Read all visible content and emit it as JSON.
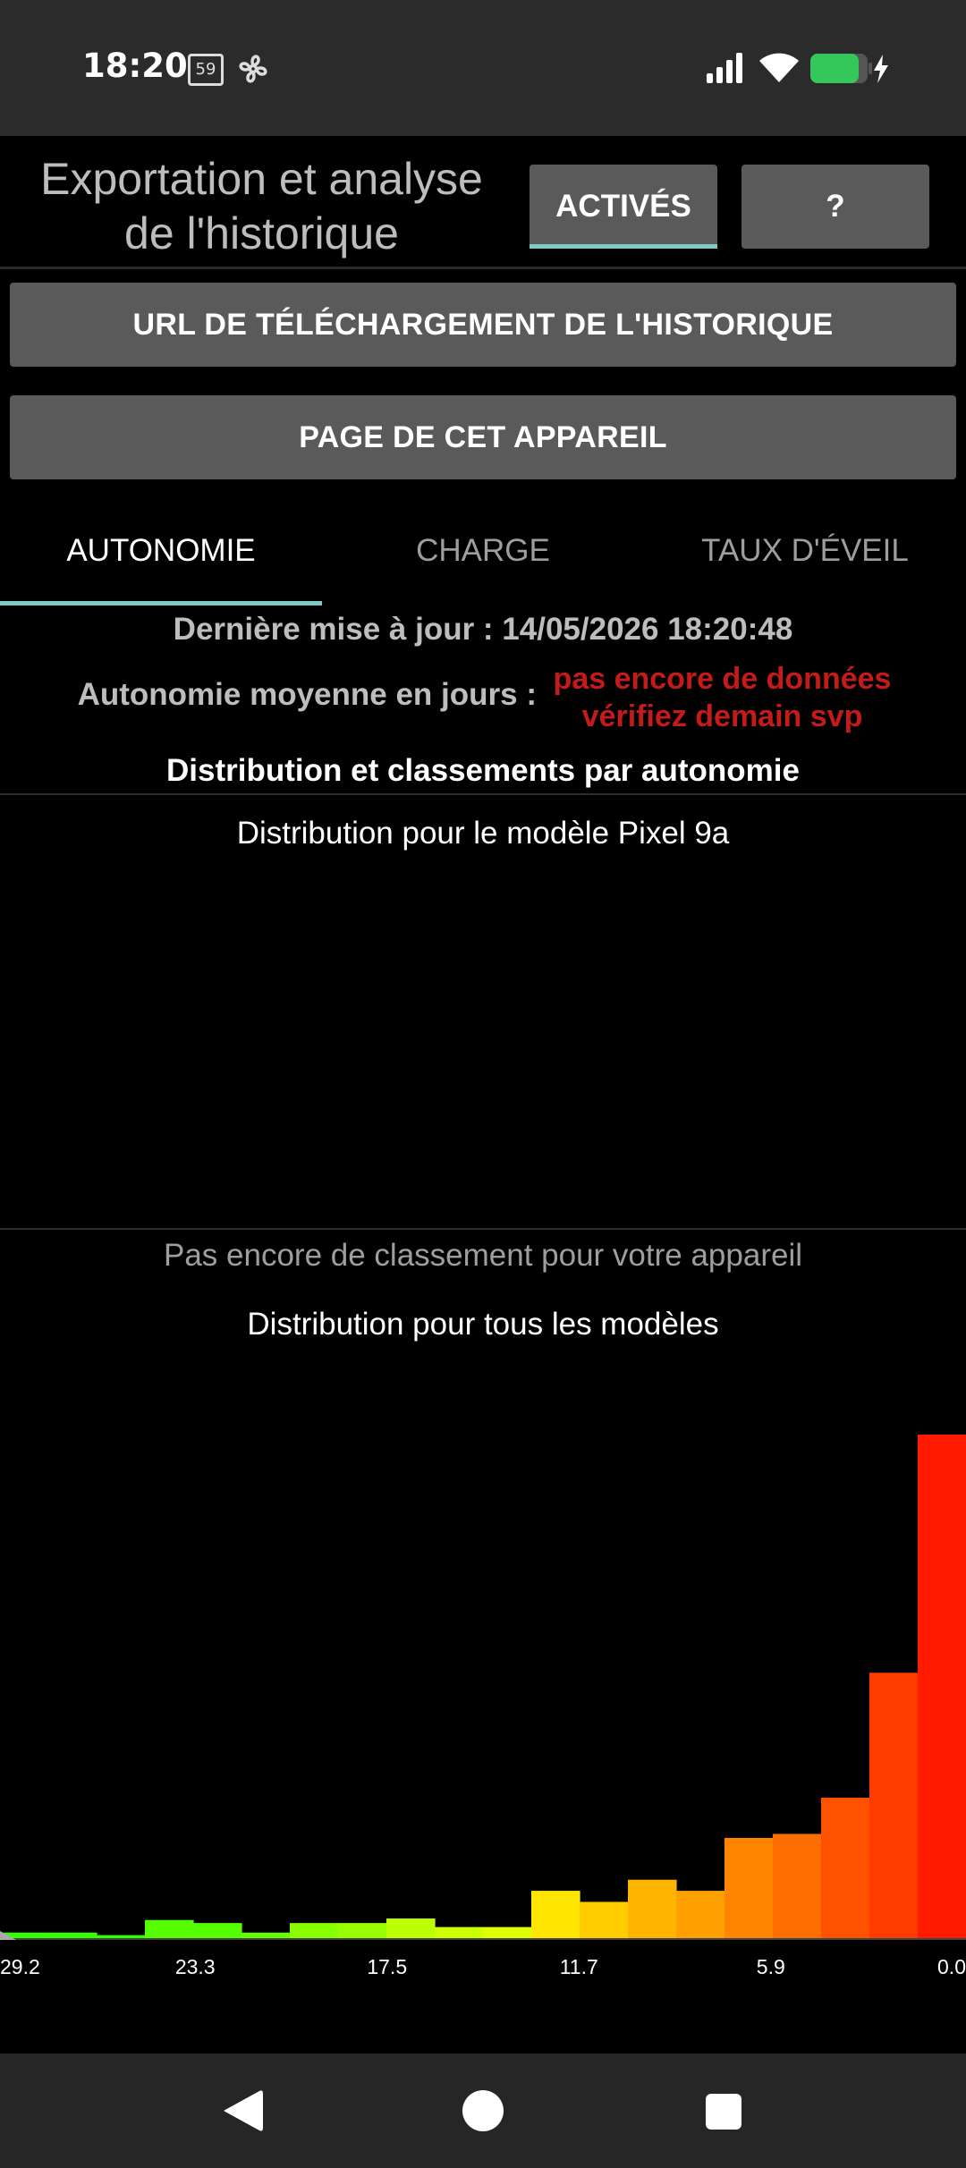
{
  "status_bar": {
    "time": "18:20",
    "calendar_badge": "59",
    "icons": [
      "calendar-icon",
      "fan-icon",
      "signal-icon",
      "wifi-icon",
      "battery-charging-icon"
    ],
    "battery_color": "#34c759"
  },
  "header": {
    "title": "Exportation et analyse de l'historique",
    "activated_label": "ACTIVÉS",
    "help_label": "?"
  },
  "buttons": {
    "history_url": "URL DE TÉLÉCHARGEMENT DE L'HISTORIQUE",
    "device_page": "PAGE DE CET APPAREIL"
  },
  "tabs": [
    {
      "label": "AUTONOMIE",
      "active": true
    },
    {
      "label": "CHARGE",
      "active": false
    },
    {
      "label": "TAUX D'ÉVEIL",
      "active": false
    }
  ],
  "info": {
    "last_update": "Dernière mise à jour : 14/05/2026 18:20:48",
    "avg_label": "Autonomie moyenne en jours  :",
    "avg_nodata_line1": "pas encore de données",
    "avg_nodata_line2": "vérifiez demain svp"
  },
  "section_title": "Distribution et classements par autonomie",
  "model_distribution": {
    "title": "Distribution pour le modèle Pixel 9a"
  },
  "no_rank_text": "Pas encore de classement pour votre appareil",
  "all_models_distribution": {
    "title": "Distribution pour tous les modèles"
  },
  "chart_data": {
    "type": "bar",
    "title": "Distribution pour tous les modèles",
    "xlabel": "",
    "ylabel": "",
    "x_ticks": [
      "29.2",
      "23.3",
      "17.5",
      "11.7",
      "5.9",
      "0.0"
    ],
    "x_range": [
      29.2,
      0.0
    ],
    "bin_count": 20,
    "values": [
      0.011,
      0.011,
      0.006,
      0.036,
      0.03,
      0.011,
      0.03,
      0.03,
      0.039,
      0.022,
      0.022,
      0.094,
      0.072,
      0.116,
      0.094,
      0.199,
      0.207,
      0.279,
      0.527,
      1.0
    ],
    "colors": [
      "#33ff00",
      "#33ff00",
      "#33ff00",
      "#55ff00",
      "#55ff00",
      "#66ff00",
      "#88ff00",
      "#99ff00",
      "#bbff00",
      "#ccff00",
      "#ddff00",
      "#ffe600",
      "#ffcc00",
      "#ffb400",
      "#ff9f00",
      "#ff8400",
      "#ff6e00",
      "#ff5200",
      "#ff3c00",
      "#ff1a00"
    ],
    "grid": false,
    "legend": false
  }
}
